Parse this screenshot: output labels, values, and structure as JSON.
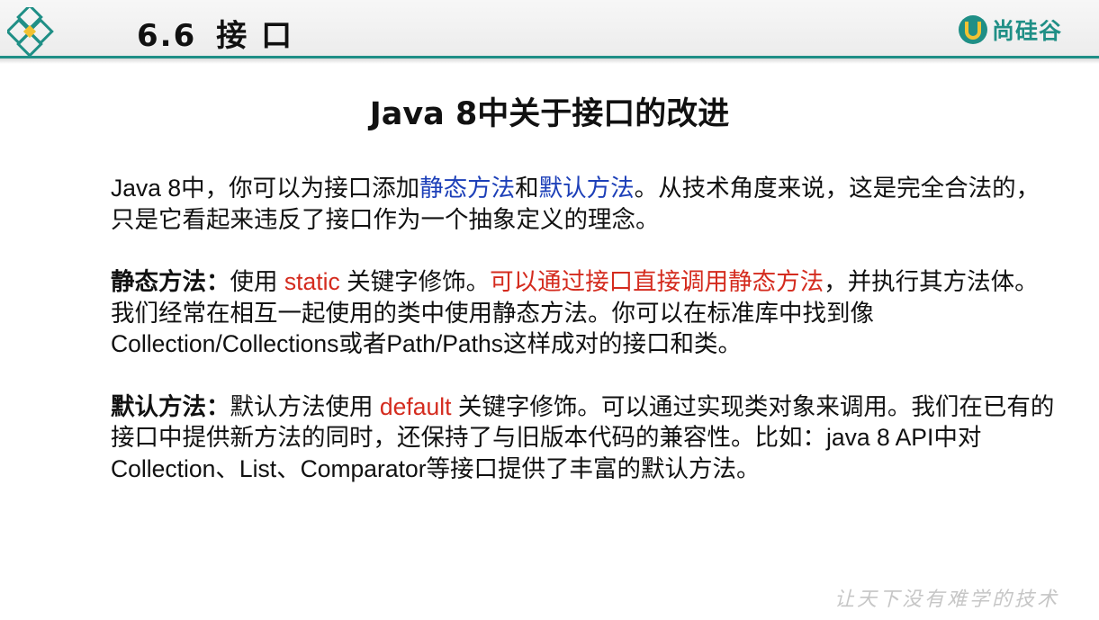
{
  "header": {
    "section_number": "6.6",
    "section_title": "接 口",
    "brand_text": "尚硅谷",
    "brand_color": "#1f8f86"
  },
  "slide_title": "Java 8中关于接口的改进",
  "paragraphs": {
    "p1": {
      "t1": "Java 8中，你可以为接口添加",
      "t2": "静态方法",
      "t3": "和",
      "t4": "默认方法",
      "t5": "。从技术角度来说，这是完全合法的，只是它看起来违反了接口作为一个抽象定义的理念。"
    },
    "p2": {
      "label": "静态方法：",
      "t1": "使用 ",
      "keyword": "static",
      "t2": " 关键字修饰。",
      "highlight": "可以通过接口直接调用静态方法",
      "t3": "，并执行其方法体。我们经常在相互一起使用的类中使用静态方法。你可以在标准库中找到像Collection/Collections或者Path/Paths这样成对的接口和类。"
    },
    "p3": {
      "label": "默认方法：",
      "t1": "默认方法使用 ",
      "keyword": "default",
      "t2": " 关键字修饰。可以通过实现类对象来调用。我们在已有的接口中提供新方法的同时，还保持了与旧版本代码的兼容性。比如：java 8 API中对Collection、List、Comparator等接口提供了丰富的默认方法。"
    }
  },
  "watermark": "让天下没有难学的技术",
  "colors": {
    "accent_blue": "#1c3fb8",
    "accent_red": "#d42b1e"
  },
  "icons": {
    "left_logo": "diamond-logo-icon",
    "brand_logo": "u-shield-logo-icon"
  }
}
